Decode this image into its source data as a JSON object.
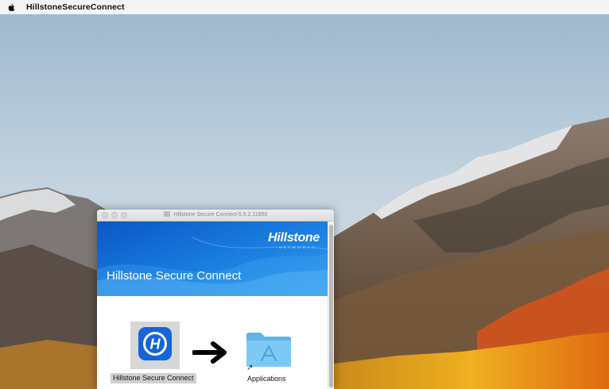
{
  "menubar": {
    "app_name": "HillstoneSecureConnect",
    "apple_icon": "apple-logo-icon"
  },
  "window": {
    "title": "Hillstone Secure Connect-5.5.2.11850",
    "banner": {
      "logo": "Hillstone",
      "logo_sub": "NETWORKS",
      "title": "Hillstone Secure Connect"
    },
    "items": [
      {
        "label": "Hillstone Secure Connect",
        "icon": "hillstone-app-icon"
      },
      {
        "label": "Applications",
        "icon": "applications-folder-icon"
      }
    ],
    "arrow_icon": "right-arrow-icon"
  },
  "colors": {
    "banner": "#1a7fe0",
    "app_icon": "#1565d8",
    "folder": "#6ec3f0"
  }
}
